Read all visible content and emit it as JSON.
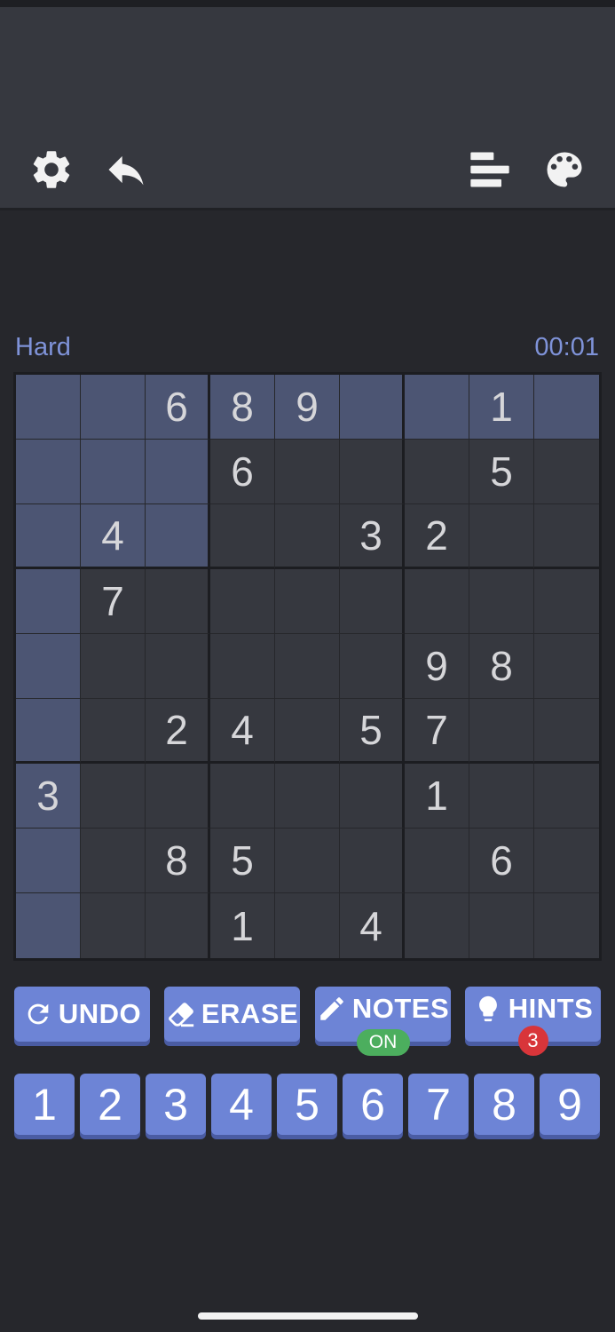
{
  "header": {
    "icons": [
      "gear-icon",
      "back-arrow-icon",
      "leaderboard-icon",
      "palette-icon"
    ]
  },
  "game": {
    "difficulty": "Hard",
    "timer": "00:01"
  },
  "board": {
    "grid": [
      [
        "",
        "",
        "6",
        "8",
        "9",
        "",
        "",
        "1",
        ""
      ],
      [
        "",
        "",
        "",
        "6",
        "",
        "",
        "",
        "5",
        ""
      ],
      [
        "",
        "4",
        "",
        "",
        "",
        "3",
        "2",
        "",
        ""
      ],
      [
        "",
        "7",
        "",
        "",
        "",
        "",
        "",
        "",
        ""
      ],
      [
        "",
        "",
        "",
        "",
        "",
        "",
        "9",
        "8",
        ""
      ],
      [
        "",
        "",
        "2",
        "4",
        "",
        "5",
        "7",
        "",
        ""
      ],
      [
        "3",
        "",
        "",
        "",
        "",
        "",
        "1",
        "",
        ""
      ],
      [
        "",
        "",
        "8",
        "5",
        "",
        "",
        "",
        "6",
        ""
      ],
      [
        "",
        "",
        "",
        "1",
        "",
        "4",
        "",
        "",
        ""
      ]
    ],
    "highlighted": [
      [
        0,
        0
      ],
      [
        0,
        1
      ],
      [
        0,
        2
      ],
      [
        0,
        3
      ],
      [
        0,
        4
      ],
      [
        0,
        5
      ],
      [
        0,
        6
      ],
      [
        0,
        7
      ],
      [
        0,
        8
      ],
      [
        1,
        0
      ],
      [
        1,
        1
      ],
      [
        1,
        2
      ],
      [
        2,
        0
      ],
      [
        2,
        1
      ],
      [
        2,
        2
      ],
      [
        3,
        0
      ],
      [
        4,
        0
      ],
      [
        5,
        0
      ],
      [
        6,
        0
      ],
      [
        7,
        0
      ],
      [
        8,
        0
      ]
    ]
  },
  "actions": {
    "undo_label": "UNDO",
    "erase_label": "ERASE",
    "notes_label": "NOTES",
    "notes_state": "ON",
    "hints_label": "HINTS",
    "hints_count": "3"
  },
  "numpad": {
    "digits": [
      "1",
      "2",
      "3",
      "4",
      "5",
      "6",
      "7",
      "8",
      "9"
    ]
  },
  "colors": {
    "accent": "#6d84d6",
    "highlight_cell": "#4c5573",
    "notes_on": "#4cae5e",
    "hints_badge": "#d8353a",
    "label_blue": "#7f93d9"
  }
}
